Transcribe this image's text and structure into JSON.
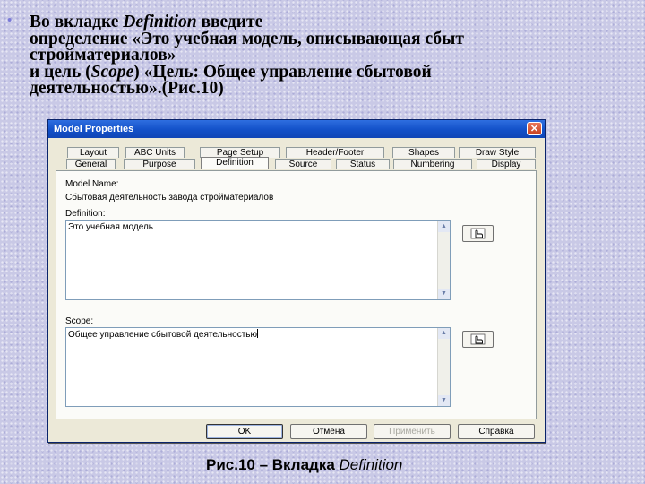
{
  "slide": {
    "bullet_symbol": "•",
    "line1_before": "Во вкладке ",
    "line1_italic": "Definition",
    "line1_after": " введите",
    "line2": "определение «Это учебная модель, описывающая сбыт",
    "line3": "стройматериалов»",
    "line4_before": "и цель (",
    "line4_italic": "Scope",
    "line4_after": ") «Цель: Общее управление сбытовой",
    "line5": "деятельностью».(Рис.10)"
  },
  "dialog": {
    "title": "Model Properties",
    "close_symbol": "✕",
    "tabs_back_row": [
      "Layout",
      "ABC Units",
      "Page Setup",
      "Header/Footer",
      "Shapes",
      "Draw Style"
    ],
    "tabs_front_row": [
      "General",
      "Purpose",
      "Definition",
      "Source",
      "Status",
      "Numbering",
      "Display"
    ],
    "active_tab": "Definition",
    "model_name_label": "Model Name:",
    "model_name_value": "Сбытовая деятельность завода стройматериалов",
    "definition_label": "Definition:",
    "definition_value": "Это учебная модель",
    "scope_label": "Scope:",
    "scope_value": "Общее управление сбытовой деятельностью",
    "buttons": {
      "ok": "OK",
      "cancel": "Отмена",
      "apply": "Применить",
      "help": "Справка"
    }
  },
  "caption": {
    "prefix": "Рис.10 – Вкладка ",
    "italic": "Definition"
  },
  "colors": {
    "titlebar": "#1250c8",
    "dialog_bg": "#ece9d8",
    "slide_bg": "#c9c9e6"
  }
}
